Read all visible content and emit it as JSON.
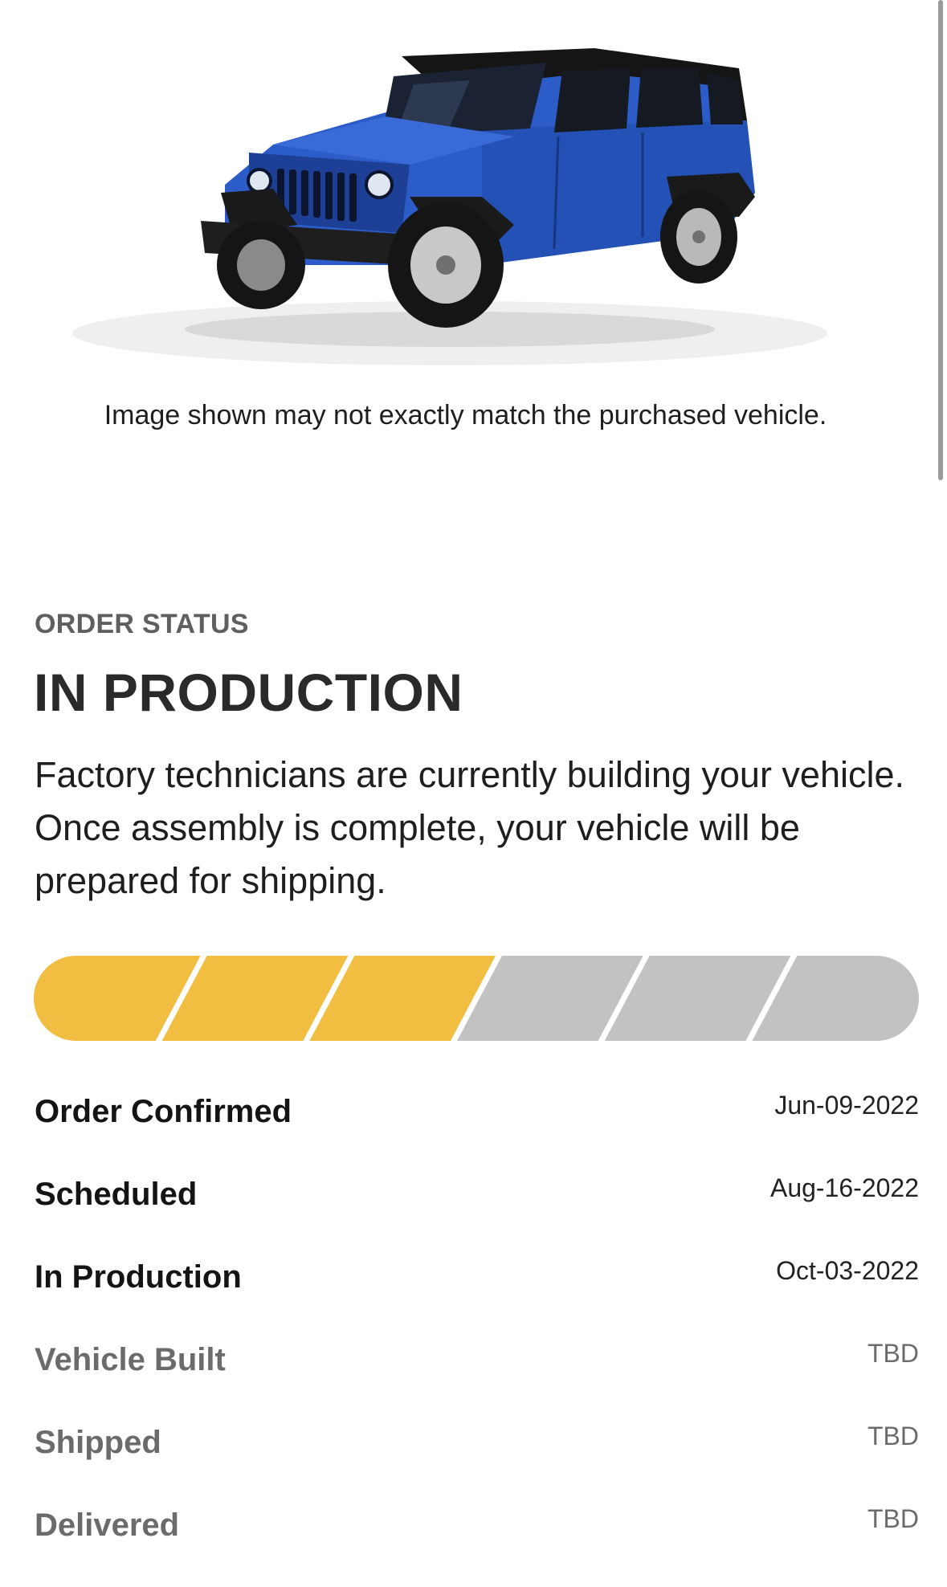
{
  "vehicle": {
    "image_name": "blue-jeep-wrangler-4-door",
    "disclaimer": "Image shown may not exactly match the purchased vehicle."
  },
  "order_status": {
    "label": "ORDER STATUS",
    "title": "IN PRODUCTION",
    "description": "Factory technicians are currently building your vehicle. Once assembly is complete, your vehicle will be prepared for shipping."
  },
  "progress": {
    "total_segments": 6,
    "completed_segments": 3,
    "completed_color": "#F2BE42",
    "pending_color": "#C2C2C2"
  },
  "milestones": [
    {
      "label": "Order Confirmed",
      "date": "Jun-09-2022",
      "done": true
    },
    {
      "label": "Scheduled",
      "date": "Aug-16-2022",
      "done": true
    },
    {
      "label": "In Production",
      "date": "Oct-03-2022",
      "done": true
    },
    {
      "label": "Vehicle Built",
      "date": "TBD",
      "done": false
    },
    {
      "label": "Shipped",
      "date": "TBD",
      "done": false
    },
    {
      "label": "Delivered",
      "date": "TBD",
      "done": false
    }
  ]
}
